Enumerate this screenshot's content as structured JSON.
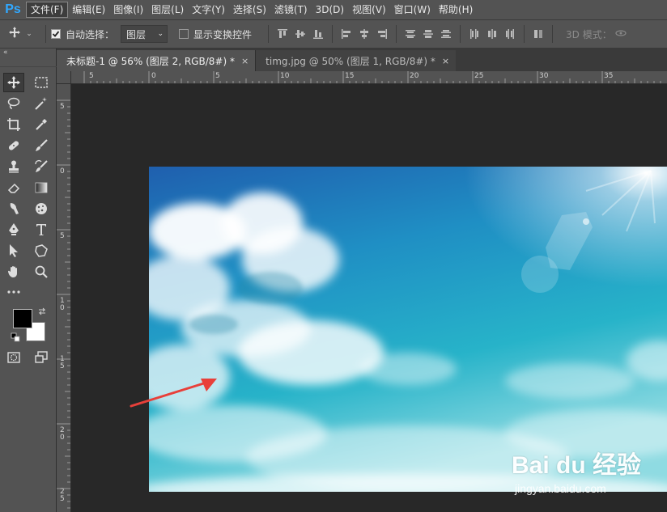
{
  "app": {
    "logo": "Ps"
  },
  "menu": [
    "文件(F)",
    "编辑(E)",
    "图像(I)",
    "图层(L)",
    "文字(Y)",
    "选择(S)",
    "滤镜(T)",
    "3D(D)",
    "视图(V)",
    "窗口(W)",
    "帮助(H)"
  ],
  "options": {
    "auto_select_label": "自动选择：",
    "auto_select_checked": true,
    "auto_select_target": "图层",
    "show_transform_label": "显示变换控件",
    "show_transform_checked": false,
    "mode_3d_label": "3D 模式："
  },
  "tabs": [
    {
      "label": "未标题-1 @ 56% (图层 2, RGB/8#) *",
      "close": "×",
      "active": true
    },
    {
      "label": "timg.jpg @ 50% (图层 1, RGB/8#) *",
      "close": "×",
      "active": false
    }
  ],
  "toolbox": {
    "collapse_label": "«"
  },
  "ruler": {
    "top_labels": [
      "5",
      "0",
      "5",
      "10",
      "15",
      "20",
      "25",
      "30",
      "35"
    ],
    "left_labels": [
      "5",
      "0",
      "5",
      "10",
      "15",
      "20",
      "25"
    ]
  },
  "colors": {
    "foreground": "#000000",
    "background": "#ffffff",
    "arrow": "#e8403a",
    "ps_blue": "#31a8ff"
  },
  "watermark": {
    "main": "Bai du 经验",
    "sub": "jingyan.baidu.com"
  }
}
